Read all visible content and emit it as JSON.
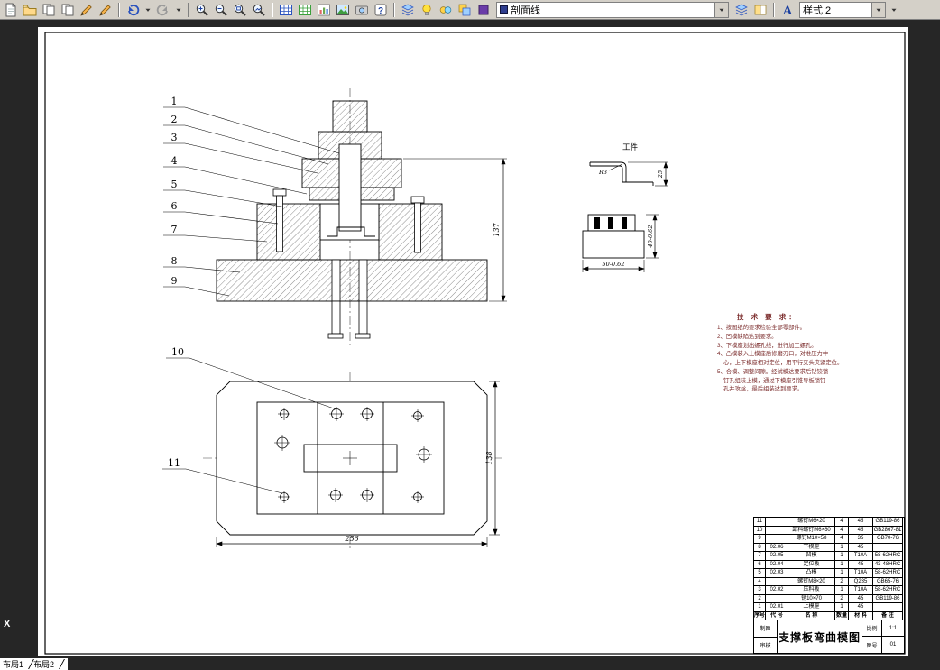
{
  "toolbar": {
    "hatch_value": "剖面线",
    "style_value": "样式 2",
    "icon_names": [
      "new",
      "open",
      "copy",
      "paste",
      "pencil",
      "pen",
      "undo",
      "undo-caret",
      "redo",
      "redo-caret",
      "zoom-in",
      "zoom-out",
      "zoom-window",
      "zoom-extents",
      "table",
      "grid",
      "chart",
      "image",
      "camera",
      "help",
      "layers",
      "bulb",
      "circles",
      "clone",
      "swatch",
      "layer-manager",
      "style-book",
      "font-style",
      "overflow-down"
    ]
  },
  "layout_tabs": [
    "布局1",
    "布局2"
  ],
  "ucs_x": "X",
  "drawing": {
    "balloons": [
      "1",
      "2",
      "3",
      "4",
      "5",
      "6",
      "7",
      "8",
      "9",
      "10",
      "11"
    ],
    "workpiece_label": "工件",
    "radius_label": "R3",
    "dims": {
      "front_height": "137",
      "plan_width": "256",
      "plan_height": "138",
      "wp_height": "25",
      "wp_width": "50-0.62",
      "wp_depth": "40-0.62"
    },
    "tech_requirements": {
      "title": "技 术 要 求：",
      "lines": [
        "1、按图纸的要求检验全部零部件。",
        "2、凹模缺陷达到要求。",
        "3、下模座划出螺孔线，进行加工螺孔。",
        "4、凸模装入上模座后修磨刃口，对准压力中",
        "心，上下模座相对定位，用平行夹头夹紧定位。",
        "5、合模、调整间隙。经试模达要求后钻铰锁",
        "钉孔组装上模，通过下模座引锥导板锁钉",
        "孔并攻丝，最后组装达到要求。"
      ]
    }
  },
  "title_block": {
    "bom_headers": [
      "序号",
      "代 号",
      "名  称",
      "数量",
      "材 料",
      "备  注"
    ],
    "bom_rows": [
      [
        "11",
        "",
        "螺钉M6×20",
        "4",
        "45",
        "GB119-86"
      ],
      [
        "10",
        "",
        "卸料螺钉M6×60",
        "4",
        "45",
        "GB2867-81"
      ],
      [
        "9",
        "",
        "螺钉M10×58",
        "4",
        "35",
        "GB70-76"
      ],
      [
        "8",
        "02.06",
        "下模座",
        "1",
        "45",
        ""
      ],
      [
        "7",
        "02.05",
        "凹模",
        "1",
        "T10A",
        "58-62HRC"
      ],
      [
        "6",
        "02.04",
        "定位板",
        "1",
        "45",
        "43-48HRC"
      ],
      [
        "5",
        "02.03",
        "凸模",
        "1",
        "T10A",
        "58-62HRC"
      ],
      [
        "4",
        "",
        "螺钉M8×20",
        "2",
        "Q235",
        "GB65-76"
      ],
      [
        "3",
        "02.02",
        "压料板",
        "1",
        "T10A",
        "58-62HRC"
      ],
      [
        "2",
        "",
        "销10×70",
        "2",
        "45",
        "GB119-86"
      ],
      [
        "1",
        "02.01",
        "上模座",
        "1",
        "45",
        ""
      ]
    ],
    "title": "支撑板弯曲模图",
    "scale_label": "比例",
    "scale_value": "1:1",
    "sheet_label": "图号",
    "sheet_value": "01",
    "drafter_label": "制图",
    "checker_label": "审核"
  }
}
